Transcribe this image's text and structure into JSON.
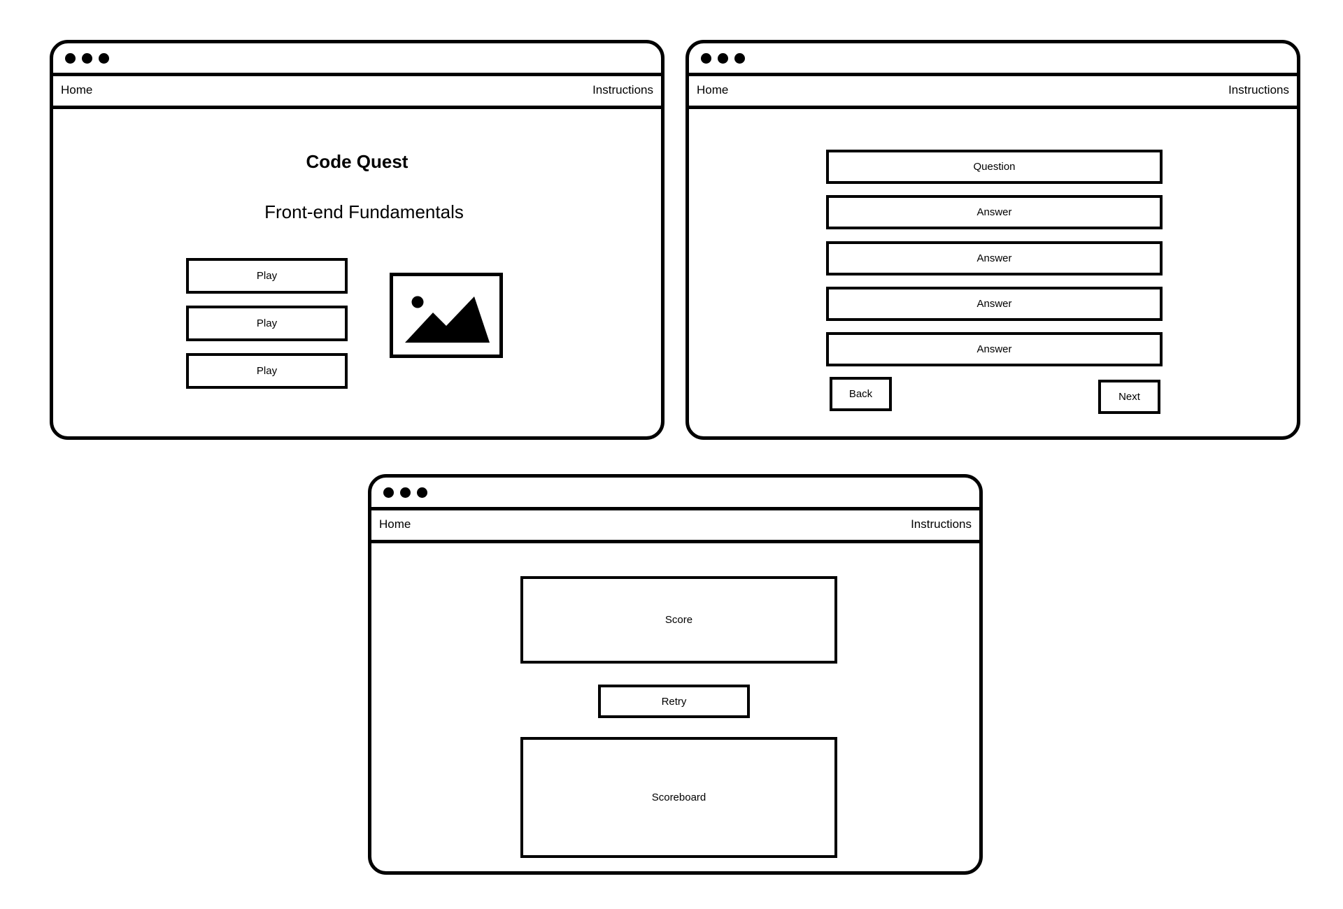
{
  "nav": {
    "home": "Home",
    "instructions": "Instructions"
  },
  "start_screen": {
    "title": "Code Quest",
    "subtitle": "Front-end Fundamentals",
    "play_buttons": [
      "Play",
      "Play",
      "Play"
    ],
    "image_icon": "image-placeholder-icon"
  },
  "quiz_screen": {
    "question": "Question",
    "answers": [
      "Answer",
      "Answer",
      "Answer",
      "Answer"
    ],
    "back": "Back",
    "next": "Next"
  },
  "results_screen": {
    "score": "Score",
    "retry": "Retry",
    "scoreboard": "Scoreboard"
  },
  "colors": {
    "ink": "#000000",
    "paper": "#ffffff"
  }
}
